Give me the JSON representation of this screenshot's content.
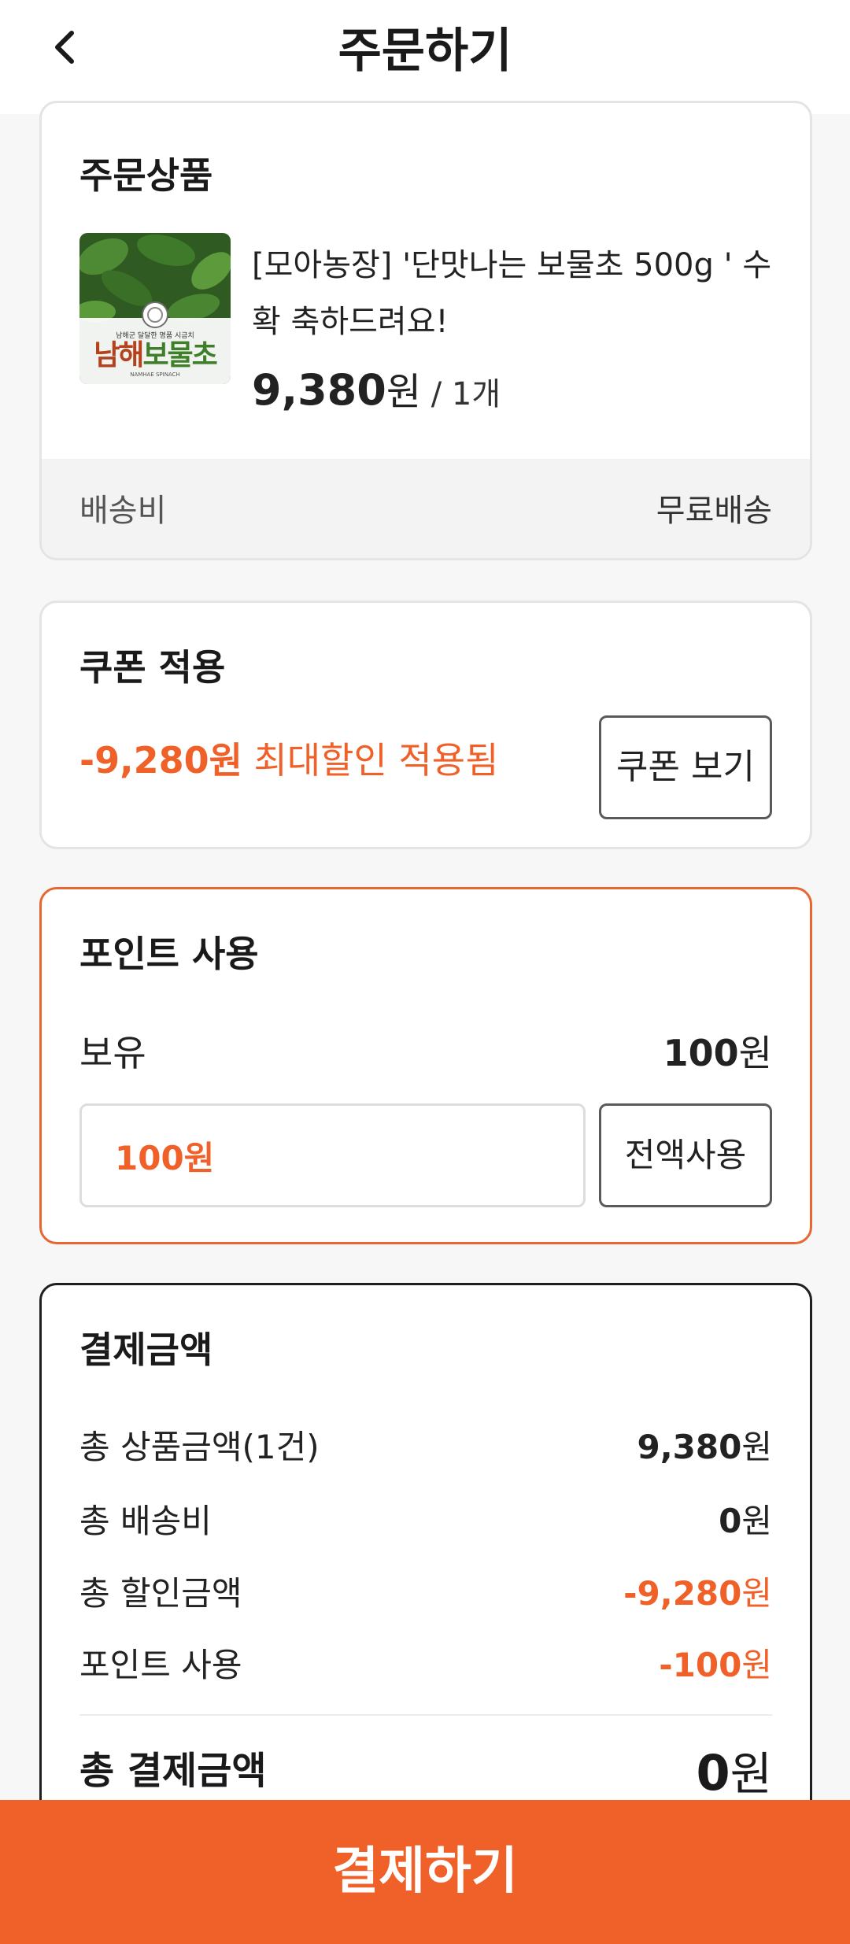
{
  "header": {
    "title": "주문하기",
    "back_icon": "chevron-left-icon"
  },
  "product_section": {
    "title": "주문상품",
    "product": {
      "name": "[모아농장] '단맛나는 보물초 500g ' 수확 축하드려요!",
      "price": "9,380",
      "currency": "원",
      "quantity": "/ 1개",
      "image_caption": "남해군 달달한 명품 시금치",
      "image_brand": "남해보물초",
      "image_brand_prefix": "남해",
      "image_brand_suffix": "보물초",
      "image_english": "NAMHAE SPINACH"
    },
    "shipping": {
      "label": "배송비",
      "value": "무료배송"
    }
  },
  "coupon_section": {
    "title": "쿠폰 적용",
    "discount_amount": "-9,280원",
    "discount_text": "최대할인 적용됨",
    "view_button": "쿠폰 보기"
  },
  "points_section": {
    "title": "포인트 사용",
    "owned_label": "보유",
    "owned_amount": "100",
    "owned_currency": "원",
    "input_value": "100원",
    "use_all_button": "전액사용"
  },
  "payment_section": {
    "title": "결제금액",
    "rows": [
      {
        "label": "총 상품금액(1건)",
        "amount": "9,380",
        "currency": "원"
      },
      {
        "label": "총 배송비",
        "amount": "0",
        "currency": "원"
      },
      {
        "label": "총 할인금액",
        "amount": "-9,280",
        "currency": "원"
      },
      {
        "label": "포인트 사용",
        "amount": "-100",
        "currency": "원"
      }
    ],
    "total_label": "총 결제금액",
    "total_amount": "0",
    "total_currency": "원"
  },
  "pay_button": "결제하기",
  "colors": {
    "accent": "#f0612a",
    "text": "#1e1e1e",
    "background": "#f7f7f7"
  }
}
